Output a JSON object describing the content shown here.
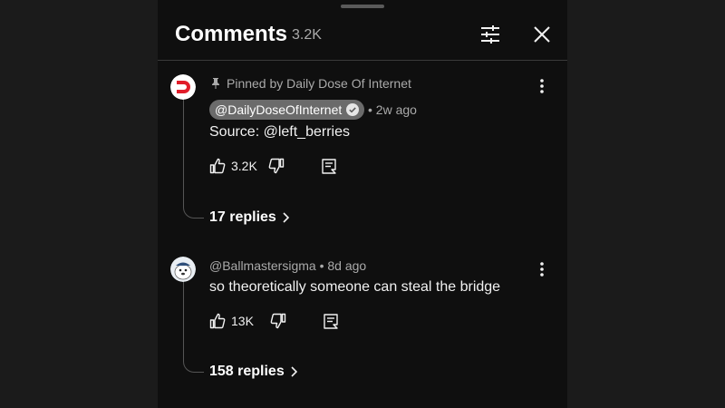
{
  "header": {
    "title": "Comments",
    "count": "3.2K"
  },
  "comments": [
    {
      "pinned_label": "Pinned by Daily Dose Of Internet",
      "author": "@DailyDoseOfInternet",
      "verified": true,
      "time": "• 2w ago",
      "text": "Source: @left_berries",
      "likes": "3.2K",
      "replies": "17 replies",
      "avatar_icon": "red-d-logo-icon"
    },
    {
      "author": "@Ballmastersigma",
      "time": "• 8d ago",
      "text": "so theoretically someone can steal the bridge",
      "likes": "13K",
      "replies": "158 replies",
      "avatar_icon": "cartoon-seal-avatar-icon"
    }
  ],
  "colors": {
    "panel_bg": "#0f0f0f",
    "outer_bg": "#1b1b1b",
    "text_primary": "#f1f1f1",
    "text_secondary": "#aaaaaa",
    "author_chip_bg": "#6b6b6b",
    "logo_red": "#e11d2a"
  }
}
